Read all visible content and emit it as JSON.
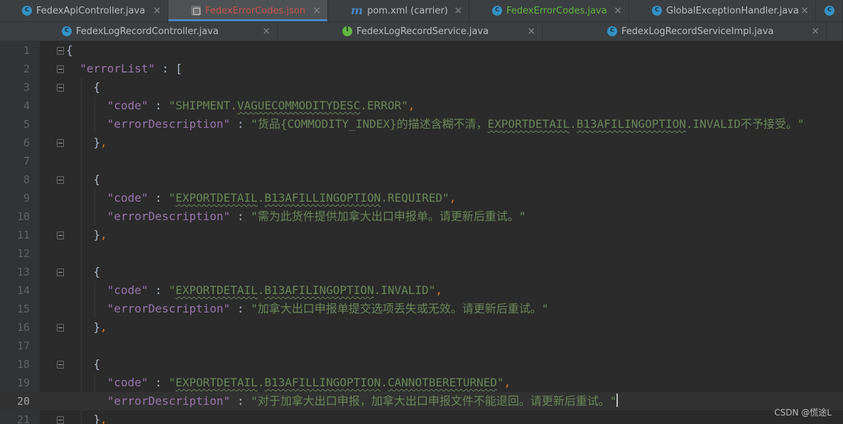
{
  "tabs_row1": [
    {
      "label": "FedexApiController.java",
      "icon": "java-class-icon",
      "state": "normal",
      "color": "#c5c5c5"
    },
    {
      "label": "FedexErrorCodes.json",
      "icon": "json-file-icon",
      "state": "active",
      "color": "#c75450"
    },
    {
      "label": "pom.xml (carrier)",
      "icon": "maven-icon",
      "state": "normal",
      "color": "#c5c5c5"
    },
    {
      "label": "FedexErrorCodes.java",
      "icon": "java-class-icon",
      "state": "modified",
      "color": "#62b543"
    },
    {
      "label": "GlobalExceptionHandler.java",
      "icon": "java-class-icon",
      "state": "normal",
      "color": "#c5c5c5"
    }
  ],
  "tabs_row2": [
    {
      "label": "FedexLogRecordController.java",
      "icon": "java-class-icon"
    },
    {
      "label": "FedexLogRecordService.java",
      "icon": "java-interface-icon"
    },
    {
      "label": "FedexLogRecordServiceImpl.java",
      "icon": "java-class-icon"
    }
  ],
  "close_glyph": "×",
  "current_line": 20,
  "lines": [
    {
      "n": "1",
      "indent": 0,
      "fold": true,
      "tokens": [
        [
          "brace",
          "{"
        ]
      ]
    },
    {
      "n": "2",
      "indent": 1,
      "fold": true,
      "tokens": [
        [
          "key",
          "\"errorList\""
        ],
        [
          "brace",
          " : "
        ],
        [
          "brace",
          "["
        ]
      ]
    },
    {
      "n": "3",
      "indent": 2,
      "fold": true,
      "tokens": [
        [
          "brace",
          "{"
        ]
      ]
    },
    {
      "n": "4",
      "indent": 3,
      "fold": false,
      "tokens": [
        [
          "key",
          "\"code\""
        ],
        [
          "brace",
          " : "
        ],
        [
          "str",
          "\"SHIPMENT."
        ],
        [
          "strU",
          "VAGUECOMMODITYDESC"
        ],
        [
          "str",
          ".ERROR\""
        ],
        [
          "punc",
          ","
        ]
      ]
    },
    {
      "n": "5",
      "indent": 3,
      "fold": false,
      "tokens": [
        [
          "key",
          "\"errorDescription\""
        ],
        [
          "brace",
          " : "
        ],
        [
          "str",
          "\"货品{COMMODITY_INDEX}的描述含糊不清，"
        ],
        [
          "strU",
          "EXPORTDETAIL"
        ],
        [
          "str",
          "."
        ],
        [
          "strU",
          "B13AFILINGOPTION"
        ],
        [
          "str",
          ".INVALID不予接受。\""
        ]
      ]
    },
    {
      "n": "6",
      "indent": 2,
      "fold": true,
      "tokens": [
        [
          "brace",
          "}"
        ],
        [
          "punc",
          ","
        ]
      ]
    },
    {
      "n": "7",
      "indent": 0,
      "fold": false,
      "tokens": []
    },
    {
      "n": "8",
      "indent": 2,
      "fold": true,
      "tokens": [
        [
          "brace",
          "{"
        ]
      ]
    },
    {
      "n": "9",
      "indent": 3,
      "fold": false,
      "tokens": [
        [
          "key",
          "\"code\""
        ],
        [
          "brace",
          " : "
        ],
        [
          "str",
          "\""
        ],
        [
          "strU",
          "EXPORTDETAIL"
        ],
        [
          "str",
          "."
        ],
        [
          "strU",
          "B13AFILLINGOPTION"
        ],
        [
          "str",
          ".REQUIRED\""
        ],
        [
          "punc",
          ","
        ]
      ]
    },
    {
      "n": "10",
      "indent": 3,
      "fold": false,
      "tokens": [
        [
          "key",
          "\"errorDescription\""
        ],
        [
          "brace",
          " : "
        ],
        [
          "str",
          "\"需为此货件提供加拿大出口申报单。请更新后重试。\""
        ]
      ]
    },
    {
      "n": "11",
      "indent": 2,
      "fold": true,
      "tokens": [
        [
          "brace",
          "}"
        ],
        [
          "punc",
          ","
        ]
      ]
    },
    {
      "n": "12",
      "indent": 0,
      "fold": false,
      "tokens": []
    },
    {
      "n": "13",
      "indent": 2,
      "fold": true,
      "tokens": [
        [
          "brace",
          "{"
        ]
      ]
    },
    {
      "n": "14",
      "indent": 3,
      "fold": false,
      "tokens": [
        [
          "key",
          "\"code\""
        ],
        [
          "brace",
          " : "
        ],
        [
          "str",
          "\""
        ],
        [
          "strU",
          "EXPORTDETAIL"
        ],
        [
          "str",
          "."
        ],
        [
          "strU",
          "B13AFILINGOPTION"
        ],
        [
          "str",
          ".INVALID\""
        ],
        [
          "punc",
          ","
        ]
      ]
    },
    {
      "n": "15",
      "indent": 3,
      "fold": false,
      "tokens": [
        [
          "key",
          "\"errorDescription\""
        ],
        [
          "brace",
          " : "
        ],
        [
          "str",
          "\"加拿大出口申报单提交选项丢失或无效。请更新后重试。\""
        ]
      ]
    },
    {
      "n": "16",
      "indent": 2,
      "fold": true,
      "tokens": [
        [
          "brace",
          "}"
        ],
        [
          "punc",
          ","
        ]
      ]
    },
    {
      "n": "17",
      "indent": 0,
      "fold": false,
      "tokens": []
    },
    {
      "n": "18",
      "indent": 2,
      "fold": true,
      "tokens": [
        [
          "brace",
          "{"
        ]
      ]
    },
    {
      "n": "19",
      "indent": 3,
      "fold": false,
      "tokens": [
        [
          "key",
          "\"code\""
        ],
        [
          "brace",
          " : "
        ],
        [
          "str",
          "\""
        ],
        [
          "strU",
          "EXPORTDETAIL"
        ],
        [
          "str",
          "."
        ],
        [
          "strU",
          "B13AFILLINGOPTION"
        ],
        [
          "str",
          "."
        ],
        [
          "strU",
          "CANNOTBERETURNED"
        ],
        [
          "str",
          "\""
        ],
        [
          "punc",
          ","
        ]
      ]
    },
    {
      "n": "20",
      "indent": 3,
      "fold": false,
      "tokens": [
        [
          "key",
          "\"errorDescription\""
        ],
        [
          "brace",
          " : "
        ],
        [
          "str",
          "\"对于加拿大出口申报，加拿大出口申报文件不能退回。请更新后重试。\""
        ],
        [
          "caret",
          ""
        ]
      ]
    },
    {
      "n": "21",
      "indent": 2,
      "fold": true,
      "tokens": [
        [
          "brace",
          "}"
        ],
        [
          "punc",
          ","
        ]
      ]
    }
  ],
  "watermark": "CSDN @慌途L"
}
